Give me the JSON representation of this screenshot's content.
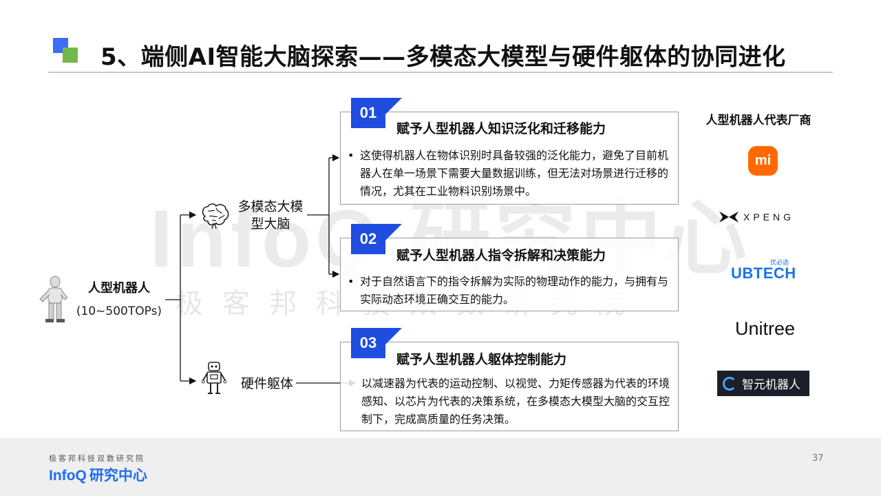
{
  "title": "5、端侧AI智能大脑探索——多模态大模型与硬件躯体的协同进化",
  "watermark": {
    "big": "InfoQ 研究中心",
    "small": "极客邦科技双数研究院"
  },
  "root": {
    "name": "人型机器人",
    "tops": "(10~500TOPs)",
    "icon": "humanoid-robot-icon"
  },
  "branches": {
    "brain_label": "多模态大模型大脑",
    "brain_icon": "brain-icon",
    "body_label": "硬件躯体",
    "body_icon": "robot-icon"
  },
  "cards": [
    {
      "number": "01",
      "title": "赋予人型机器人知识泛化和迁移能力",
      "bullet": "这使得机器人在物体识别时具备较强的泛化能力，避免了目前机器人在单一场景下需要大量数据训练，但无法对场景进行迁移的情况，尤其在工业物料识别场景中。"
    },
    {
      "number": "02",
      "title": "赋予人型机器人指令拆解和决策能力",
      "bullet": "对于自然语言下的指令拆解为实际的物理动作的能力，与拥有与实际动态环境正确交互的能力。"
    },
    {
      "number": "03",
      "title": "赋予人型机器人躯体控制能力",
      "bullet": "以减速器为代表的运动控制、以视觉、力矩传感器为代表的环境感知、以芯片为代表的决策系统，在多模态大模型大脑的交互控制下，完成高质量的任务决策。"
    }
  ],
  "vendors": {
    "title": "人型机器人代表厂商",
    "mi": "mi",
    "xpeng": "XPENG",
    "ubtech_small": "优必选",
    "ubtech": "UBTECH",
    "unitree": "Unitree",
    "agibot": "智元机器人"
  },
  "footer": {
    "subtitle": "极客邦科技双数研究院",
    "brand": "InfoQ",
    "brand_center": "研究中心",
    "page": "37"
  },
  "colors": {
    "accent_blue": "#1f4de0",
    "logo_blue": "#3b6ef5",
    "logo_green": "#72b84a",
    "mi_orange": "#ff6a00"
  }
}
